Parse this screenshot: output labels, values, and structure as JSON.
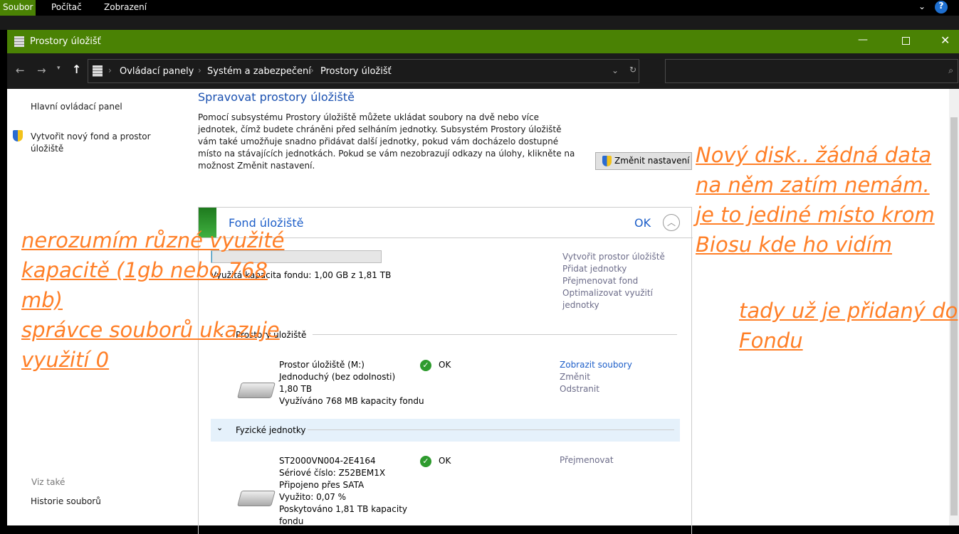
{
  "menubar": {
    "items": [
      "Soubor",
      "Počítač",
      "Zobrazení"
    ]
  },
  "window": {
    "title": "Prostory úložišť",
    "controls": [
      "minimize",
      "maximize",
      "close"
    ]
  },
  "address": {
    "crumbs": [
      "Ovládací panely",
      "Systém a zabezpečení",
      "Prostory úložišť"
    ],
    "search_placeholder": ""
  },
  "sidebar": {
    "home": "Hlavní ovládací panel",
    "create": "Vytvořit nový fond a prostor úložiště",
    "see_also": "Viz také",
    "history": "Historie souborů"
  },
  "main": {
    "title": "Spravovat prostory úložiště",
    "description": "Pomocí subsystému Prostory úložiště můžete ukládat soubory na dvě nebo více jednotek, čímž budete chráněni před selháním jednotky. Subsystém Prostory úložiště vám také umožňuje snadno přidávat další jednotky, pokud vám docházelo dostupné místo na stávajících jednotkách. Pokud se vám nezobrazují odkazy na úlohy, klikněte na možnost Změnit nastavení.",
    "change_settings": "Změnit nastavení",
    "pool": {
      "title": "Fond úložiště",
      "status": "OK",
      "usage_fraction": 0.0005,
      "usage_text": "Využitá kapacita fondu: 1,00 GB z 1,81 TB",
      "actions": [
        "Vytvořit prostor úložiště",
        "Přidat jednotky",
        "Přejmenovat fond",
        "Optimalizovat využití jednotky"
      ]
    },
    "spaces_header": "Prostory úložiště",
    "space": {
      "lines": [
        "Prostor úložiště (M:)",
        "Jednoduchý (bez odolnosti)",
        "1,80 TB",
        "Využíváno 768 MB kapacity fondu"
      ],
      "status": "OK",
      "actions": [
        "Zobrazit soubory",
        "Změnit",
        "Odstranit"
      ]
    },
    "physical_header": "Fyzické jednotky",
    "disk": {
      "lines": [
        "ST2000VN004-2E4164",
        "Sériové číslo: Z52BEM1X",
        "Připojeno přes SATA",
        "Využito: 0,07 %",
        "Poskytováno 1,81 TB kapacity fondu"
      ],
      "status": "OK",
      "actions": [
        "Přejmenovat"
      ]
    }
  },
  "annotations": {
    "left": [
      "nerozumím různé využité",
      "kapacitě (1gb nebo 768",
      "mb)",
      "správce souborů ukazuje",
      "využití 0"
    ],
    "right_top": [
      "Nový disk.. žádná data",
      "na něm zatím nemám.",
      "je to jediné místo krom",
      "Biosu kde ho vidím"
    ],
    "right_bottom": [
      "tady už je přidaný do",
      "Fondu"
    ]
  },
  "colors": {
    "accent": "#4a8204",
    "annotation": "#ff7f27",
    "link": "#1e5fc9"
  }
}
